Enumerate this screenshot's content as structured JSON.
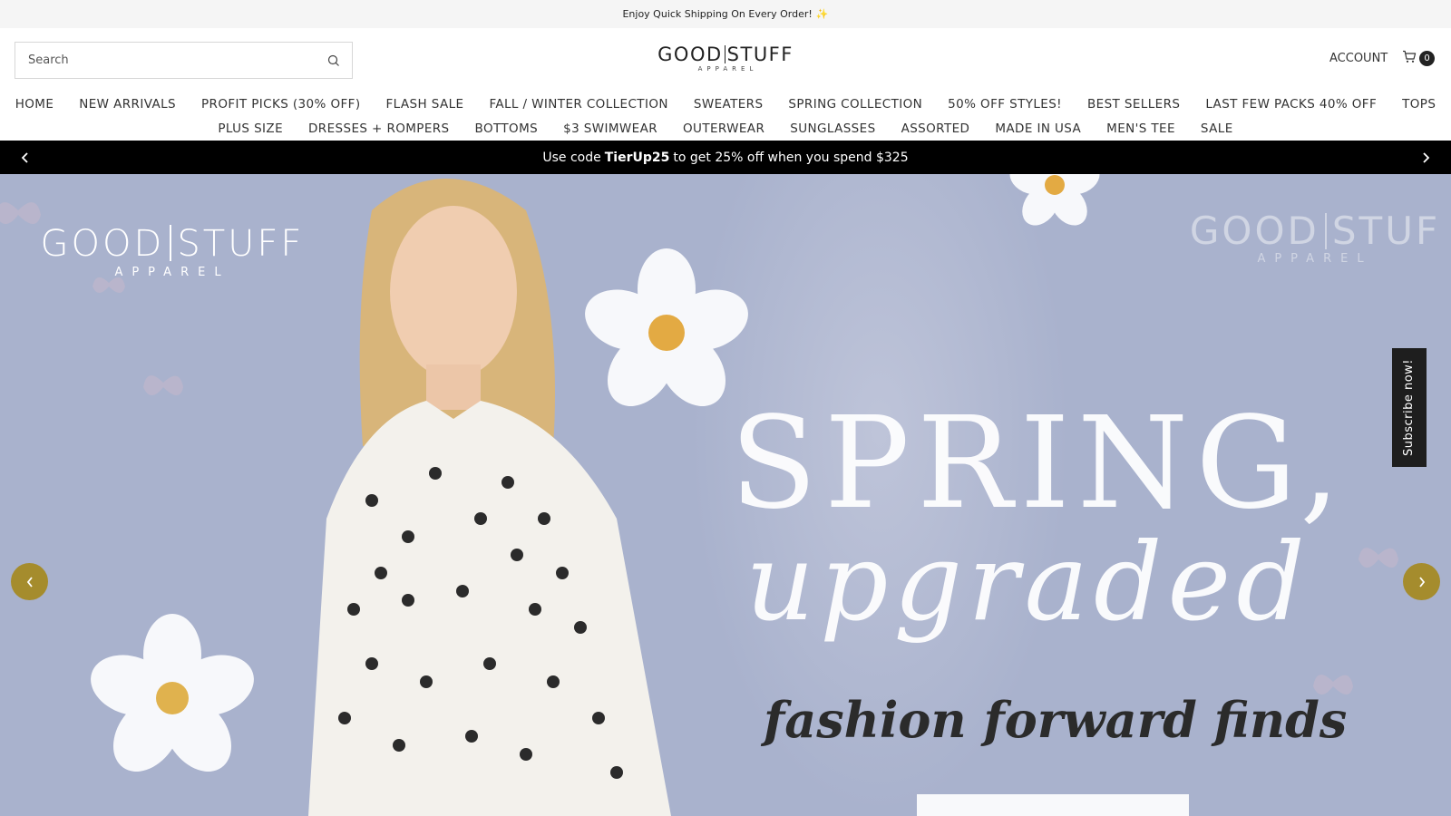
{
  "announcement": {
    "text": "Enjoy Quick Shipping On Every Order!",
    "emoji": "✨"
  },
  "header": {
    "search_placeholder": "Search",
    "logo": {
      "main_left": "GOOD",
      "main_right": "STUFF",
      "sub": "APPAREL"
    },
    "account_label": "ACCOUNT",
    "cart_count": "0"
  },
  "nav": {
    "row1": [
      "HOME",
      "NEW ARRIVALS",
      "PROFIT PICKS (30% OFF)",
      "FLASH SALE",
      "FALL / WINTER COLLECTION",
      "SWEATERS",
      "SPRING COLLECTION",
      "50% OFF STYLES!",
      "BEST SELLERS",
      "LAST FEW PACKS 40% OFF",
      "TOPS"
    ],
    "row2": [
      "PLUS SIZE",
      "DRESSES + ROMPERS",
      "BOTTOMS",
      "$3 SWIMWEAR",
      "OUTERWEAR",
      "SUNGLASSES",
      "ASSORTED",
      "MADE IN USA",
      "MEN'S TEE",
      "SALE"
    ]
  },
  "promo": {
    "prefix": "Use code",
    "code": "TierUp25",
    "suffix": "to get 25% off when you spend $325"
  },
  "hero": {
    "logo": {
      "main_left": "GOOD",
      "main_right": "STUFF",
      "sub": "APPAREL"
    },
    "logo_faded": {
      "main_left": "GOOD",
      "main_right": "STUF",
      "sub": "APPAREL"
    },
    "headline_1": "SPRING,",
    "headline_2": "upgraded",
    "tagline": "fashion forward finds",
    "subscribe_label": "Subscribe now!"
  },
  "colors": {
    "hero_bg": "#a9b2cd",
    "slider_arrow": "#a58c2d",
    "promo_bg": "#000000"
  }
}
